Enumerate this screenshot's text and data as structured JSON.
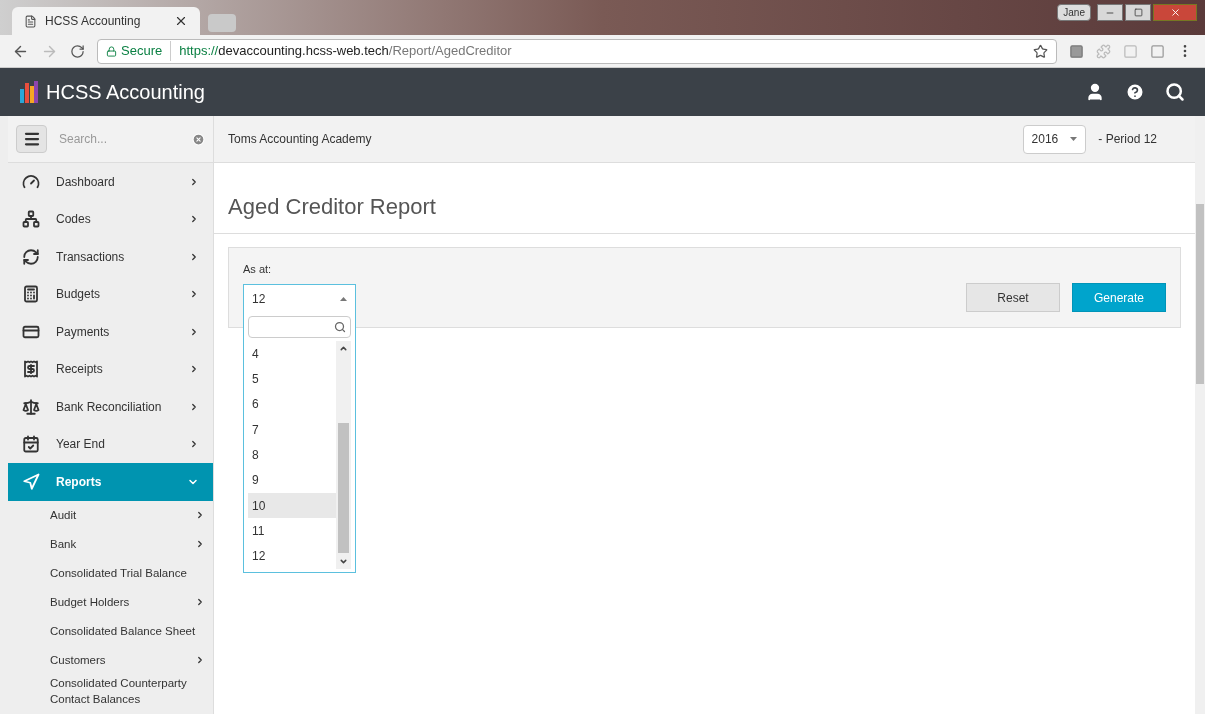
{
  "browser": {
    "tab_title": "HCSS Accounting",
    "user": "Jane",
    "secure_label": "Secure",
    "url_scheme": "https://",
    "url_host": "devaccounting.hcss-web.tech",
    "url_path": "/Report/AgedCreditor"
  },
  "app": {
    "brand": "HCSS Accounting"
  },
  "sidebar": {
    "search_placeholder": "Search...",
    "items": [
      {
        "label": "Dashboard",
        "expanded": false,
        "selected": false
      },
      {
        "label": "Codes",
        "expanded": false,
        "selected": false
      },
      {
        "label": "Transactions",
        "expanded": false,
        "selected": false
      },
      {
        "label": "Budgets",
        "expanded": false,
        "selected": false
      },
      {
        "label": "Payments",
        "expanded": false,
        "selected": false
      },
      {
        "label": "Receipts",
        "expanded": false,
        "selected": false
      },
      {
        "label": "Bank Reconciliation",
        "expanded": false,
        "selected": false
      },
      {
        "label": "Year End",
        "expanded": false,
        "selected": false
      },
      {
        "label": "Reports",
        "expanded": true,
        "selected": true,
        "children": [
          {
            "label": "Audit",
            "has_submenu": true
          },
          {
            "label": "Bank",
            "has_submenu": true
          },
          {
            "label": "Consolidated Trial Balance",
            "has_submenu": false
          },
          {
            "label": "Budget Holders",
            "has_submenu": true
          },
          {
            "label": "Consolidated Balance Sheet",
            "has_submenu": false
          },
          {
            "label": "Customers",
            "has_submenu": true
          },
          {
            "label": "Consolidated Counterparty Contact Balances",
            "has_submenu": false
          }
        ]
      }
    ]
  },
  "context_bar": {
    "organisation": "Toms Accounting Academy",
    "year": "2016",
    "period": "- Period 12"
  },
  "page": {
    "title": "Aged Creditor Report",
    "form": {
      "as_at_label": "As at:",
      "as_at_value": "12",
      "dropdown_open": true,
      "options": [
        {
          "label": "4",
          "selected": false
        },
        {
          "label": "5",
          "selected": false
        },
        {
          "label": "6",
          "selected": false
        },
        {
          "label": "7",
          "selected": false
        },
        {
          "label": "8",
          "selected": false
        },
        {
          "label": "9",
          "selected": false
        },
        {
          "label": "10",
          "selected": true
        },
        {
          "label": "11",
          "selected": false
        },
        {
          "label": "12",
          "selected": false
        }
      ]
    },
    "buttons": [
      {
        "label": "Reset",
        "kind": "secondary"
      },
      {
        "label": "Generate",
        "kind": "primary"
      }
    ]
  }
}
